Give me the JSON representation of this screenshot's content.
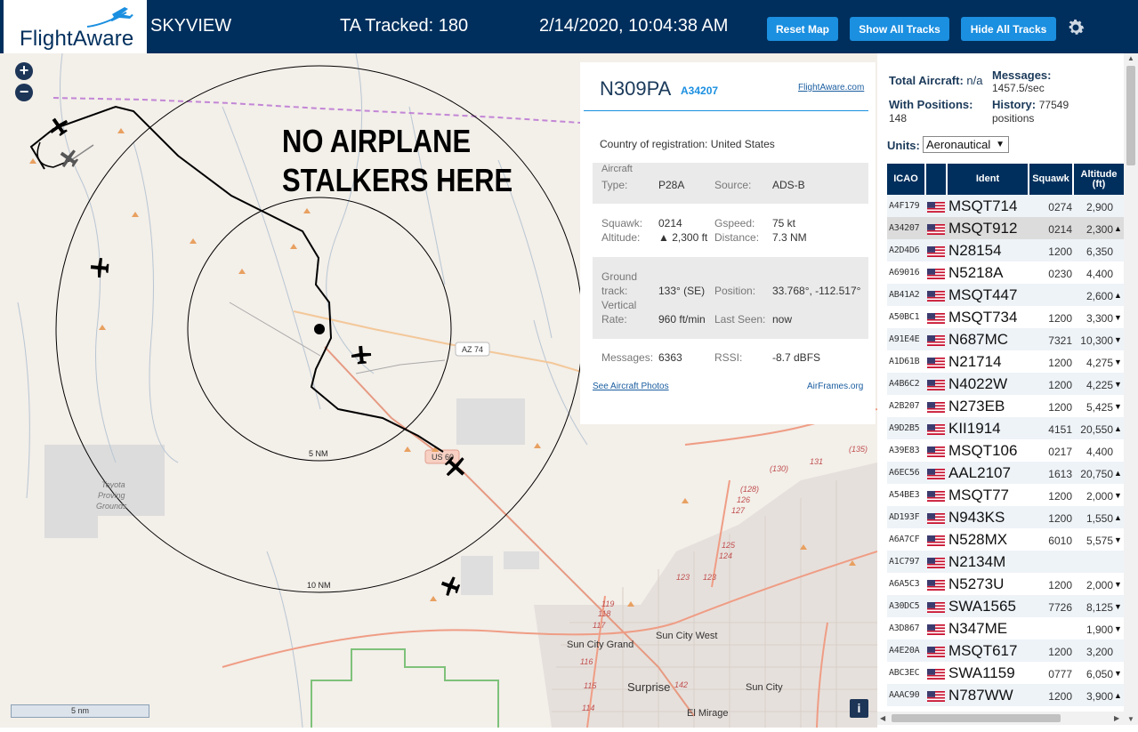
{
  "header": {
    "logo_text": "FlightAware",
    "title": "SKYVIEW",
    "tracked": "TA Tracked: 180",
    "datetime": "2/14/2020, 10:04:38 AM",
    "buttons": {
      "reset": "Reset Map",
      "show": "Show All Tracks",
      "hide": "Hide All Tracks"
    }
  },
  "map": {
    "zoom_in": "+",
    "zoom_out": "−",
    "overlay_text": [
      "NO AIRPLANE",
      "STALKERS HERE"
    ],
    "ring_labels": [
      "5 NM",
      "10 NM"
    ],
    "road_labels": [
      "AZ 74",
      "US 60"
    ],
    "place_labels": [
      "Toyota",
      "Proving",
      "Grounds",
      "Sun City Grand",
      "Sun City West",
      "Surprise",
      "Sun City",
      "El Mirage"
    ],
    "route_numbers": [
      "(130)",
      "131",
      "(135)",
      "(128)",
      "126",
      "127",
      "125",
      "124",
      "123",
      "123",
      "119",
      "118",
      "117",
      "116",
      "115",
      "114",
      "142"
    ],
    "scale_label": "5 nm",
    "info_button": "i"
  },
  "popup": {
    "registration": "N309PA",
    "icao": "A34207",
    "fa_link": "FlightAware.com",
    "country_label": "Country of registration:",
    "country": "United States",
    "aircraft_label": "Aircraft",
    "type_label": "Type:",
    "type": "P28A",
    "source_label": "Source:",
    "source": "ADS-B",
    "squawk_label": "Squawk:",
    "squawk": "0214",
    "gspeed_label": "Gspeed:",
    "gspeed": "75 kt",
    "altitude_label": "Altitude:",
    "altitude": "▲ 2,300 ft",
    "distance_label": "Distance:",
    "distance": "7.3 NM",
    "ground_label": "Ground",
    "track_label": "track:",
    "track": "133° (SE)",
    "position_label": "Position:",
    "position": "33.768°, -112.517°",
    "vertical_label": "Vertical",
    "rate_label": "Rate:",
    "rate": "960 ft/min",
    "lastseen_label": "Last Seen:",
    "lastseen": "now",
    "messages_label": "Messages:",
    "messages": "6363",
    "rssi_label": "RSSI:",
    "rssi": "-8.7 dBFS",
    "photos_link": "See Aircraft Photos",
    "airframes_link": "AirFrames.org"
  },
  "stats": {
    "total_label": "Total Aircraft:",
    "total": "n/a",
    "messages_label": "Messages:",
    "messages": "1457.5/sec",
    "withpos_label": "With Positions:",
    "withpos": "148",
    "history_label": "History:",
    "history": "77549",
    "history_unit": "positions",
    "units_label": "Units:",
    "units_value": "Aeronautical"
  },
  "table": {
    "headers": {
      "icao": "ICAO",
      "ident": "Ident",
      "squawk": "Squawk",
      "altitude": "Altitude",
      "altitude_unit": "(ft)"
    },
    "rows": [
      {
        "icao": "A4F179",
        "ident": "MSQT714",
        "squawk": "0274",
        "alt": "2,900",
        "arrow": ""
      },
      {
        "icao": "A34207",
        "ident": "MSQT912",
        "squawk": "0214",
        "alt": "2,300",
        "arrow": "▲"
      },
      {
        "icao": "A2D4D6",
        "ident": "N28154",
        "squawk": "1200",
        "alt": "6,350",
        "arrow": ""
      },
      {
        "icao": "A69016",
        "ident": "N5218A",
        "squawk": "0230",
        "alt": "4,400",
        "arrow": ""
      },
      {
        "icao": "AB41A2",
        "ident": "MSQT447",
        "squawk": "",
        "alt": "2,600",
        "arrow": "▲"
      },
      {
        "icao": "A50BC1",
        "ident": "MSQT734",
        "squawk": "1200",
        "alt": "3,300",
        "arrow": "▼"
      },
      {
        "icao": "A91E4E",
        "ident": "N687MC",
        "squawk": "7321",
        "alt": "10,300",
        "arrow": "▼"
      },
      {
        "icao": "A1D61B",
        "ident": "N21714",
        "squawk": "1200",
        "alt": "4,275",
        "arrow": "▼"
      },
      {
        "icao": "A4B6C2",
        "ident": "N4022W",
        "squawk": "1200",
        "alt": "4,225",
        "arrow": "▼"
      },
      {
        "icao": "A2B207",
        "ident": "N273EB",
        "squawk": "1200",
        "alt": "5,425",
        "arrow": "▼"
      },
      {
        "icao": "A9D2B5",
        "ident": "KII1914",
        "squawk": "4151",
        "alt": "20,550",
        "arrow": "▲"
      },
      {
        "icao": "A39E83",
        "ident": "MSQT106",
        "squawk": "0217",
        "alt": "4,400",
        "arrow": ""
      },
      {
        "icao": "A6EC56",
        "ident": "AAL2107",
        "squawk": "1613",
        "alt": "20,750",
        "arrow": "▲"
      },
      {
        "icao": "A54BE3",
        "ident": "MSQT77",
        "squawk": "1200",
        "alt": "2,000",
        "arrow": "▼"
      },
      {
        "icao": "AD193F",
        "ident": "N943KS",
        "squawk": "1200",
        "alt": "1,550",
        "arrow": "▲"
      },
      {
        "icao": "A6A7CF",
        "ident": "N528MX",
        "squawk": "6010",
        "alt": "5,575",
        "arrow": "▼"
      },
      {
        "icao": "A1C797",
        "ident": "N2134M",
        "squawk": "",
        "alt": "",
        "arrow": ""
      },
      {
        "icao": "A6A5C3",
        "ident": "N5273U",
        "squawk": "1200",
        "alt": "2,000",
        "arrow": "▼"
      },
      {
        "icao": "A30DC5",
        "ident": "SWA1565",
        "squawk": "7726",
        "alt": "8,125",
        "arrow": "▼"
      },
      {
        "icao": "A3D867",
        "ident": "N347ME",
        "squawk": "",
        "alt": "1,900",
        "arrow": "▼"
      },
      {
        "icao": "A4E20A",
        "ident": "MSQT617",
        "squawk": "1200",
        "alt": "3,200",
        "arrow": ""
      },
      {
        "icao": "ABC3EC",
        "ident": "SWA1159",
        "squawk": "0777",
        "alt": "6,050",
        "arrow": "▼"
      },
      {
        "icao": "AAAC90",
        "ident": "N787WW",
        "squawk": "1200",
        "alt": "3,900",
        "arrow": "▲"
      }
    ]
  },
  "colors": {
    "header": "#002f5d",
    "accent": "#1b8fe0",
    "map_bg": "#f3efe9",
    "selected_row": "#dcdcdc"
  }
}
